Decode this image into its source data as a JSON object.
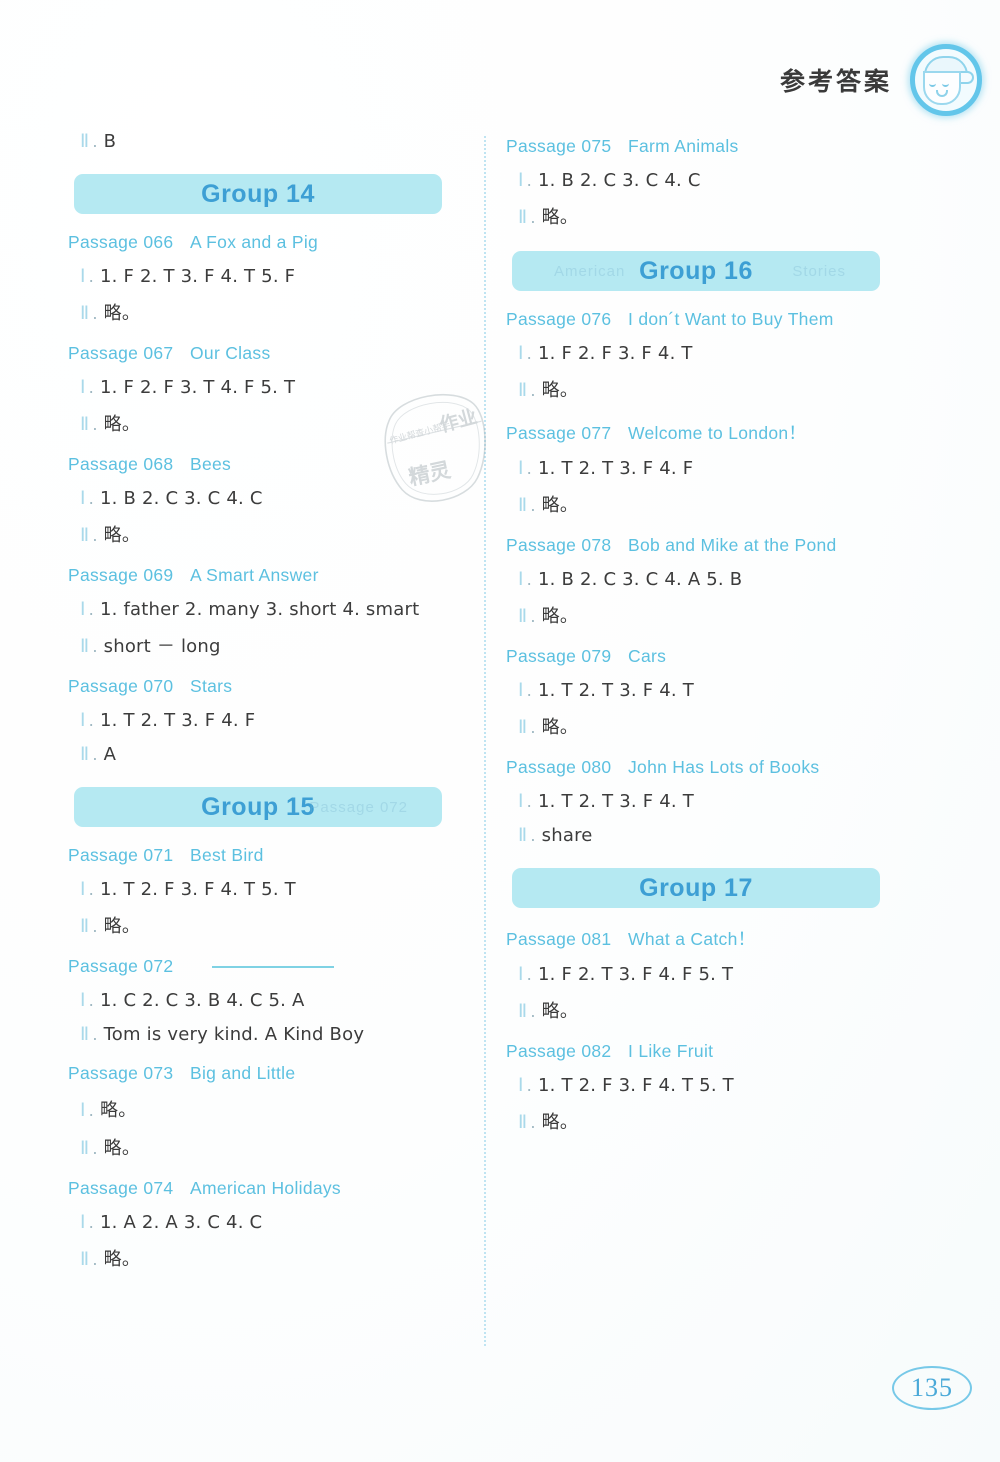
{
  "header": {
    "title": "参考答案",
    "mascot_icon": "boy-with-cap-avatar-icon"
  },
  "page_number": "135",
  "watermark": {
    "text_top": "作业",
    "text_mid": "作业帮查小帮手",
    "text_bottom": "精灵"
  },
  "left_column": {
    "orphan_answer": {
      "numeral": "Ⅱ",
      "text": "B"
    },
    "blocks": [
      {
        "type": "group",
        "title": "Group 14",
        "ghost_left": "",
        "ghost_right": ""
      },
      {
        "type": "passage",
        "number": "Passage 066",
        "title": "A Fox and a Pig",
        "answers": [
          {
            "numeral": "Ⅰ",
            "text": "1. F  2. T  3. F  4. T  5. F"
          },
          {
            "numeral": "Ⅱ",
            "text": "略。"
          }
        ]
      },
      {
        "type": "passage",
        "number": "Passage 067",
        "title": "Our Class",
        "answers": [
          {
            "numeral": "Ⅰ",
            "text": "1. F  2. F  3. T  4. F  5. T"
          },
          {
            "numeral": "Ⅱ",
            "text": "略。"
          }
        ]
      },
      {
        "type": "passage",
        "number": "Passage 068",
        "title": "Bees",
        "answers": [
          {
            "numeral": "Ⅰ",
            "text": "1. B  2. C  3. C  4. C"
          },
          {
            "numeral": "Ⅱ",
            "text": "略。"
          }
        ]
      },
      {
        "type": "passage",
        "number": "Passage 069",
        "title": "A Smart Answer",
        "answers": [
          {
            "numeral": "Ⅰ",
            "text": "1. father  2. many  3. short  4. smart"
          },
          {
            "numeral": "Ⅱ",
            "text": "short － long"
          }
        ]
      },
      {
        "type": "passage",
        "number": "Passage 070",
        "title": "Stars",
        "answers": [
          {
            "numeral": "Ⅰ",
            "text": "1. T  2. T  3. F  4. F"
          },
          {
            "numeral": "Ⅱ",
            "text": "A"
          }
        ]
      },
      {
        "type": "group",
        "title": "Group 15",
        "ghost_left": "",
        "ghost_right": "Passage 072"
      },
      {
        "type": "passage",
        "number": "Passage 071",
        "title": "Best Bird",
        "answers": [
          {
            "numeral": "Ⅰ",
            "text": "1. T  2. F  3. F  4. T  5. T"
          },
          {
            "numeral": "Ⅱ",
            "text": "略。"
          }
        ]
      },
      {
        "type": "passage",
        "number": "Passage 072",
        "title": "",
        "title_is_blank": true,
        "answers": [
          {
            "numeral": "Ⅰ",
            "text": "1. C  2. C  3. B  4. C  5. A"
          },
          {
            "numeral": "Ⅱ",
            "text": "Tom is very kind.    A Kind Boy"
          }
        ]
      },
      {
        "type": "passage",
        "number": "Passage 073",
        "title": "Big and Little",
        "answers": [
          {
            "numeral": "Ⅰ",
            "text": "略。"
          },
          {
            "numeral": "Ⅱ",
            "text": "略。"
          }
        ]
      },
      {
        "type": "passage",
        "number": "Passage 074",
        "title": "American Holidays",
        "answers": [
          {
            "numeral": "Ⅰ",
            "text": "1. A  2. A  3. C  4. C"
          },
          {
            "numeral": "Ⅱ",
            "text": "略。"
          }
        ]
      }
    ]
  },
  "right_column": {
    "blocks": [
      {
        "type": "passage",
        "number": "Passage 075",
        "title": "Farm Animals",
        "answers": [
          {
            "numeral": "Ⅰ",
            "text": "1. B  2. C  3. C  4. C"
          },
          {
            "numeral": "Ⅱ",
            "text": "略。"
          }
        ]
      },
      {
        "type": "group",
        "title": "Group 16",
        "ghost_left": "American",
        "ghost_right": "Stories"
      },
      {
        "type": "passage",
        "number": "Passage 076",
        "title": "I don´t Want to Buy Them",
        "answers": [
          {
            "numeral": "Ⅰ",
            "text": "1. F  2. F  3. F   4. T"
          },
          {
            "numeral": "Ⅱ",
            "text": "略。"
          }
        ]
      },
      {
        "type": "passage",
        "number": "Passage 077",
        "title": "Welcome to London！",
        "answers": [
          {
            "numeral": "Ⅰ",
            "text": "1. T  2. T  3. F   4. F"
          },
          {
            "numeral": "Ⅱ",
            "text": "略。"
          }
        ]
      },
      {
        "type": "passage",
        "number": "Passage 078",
        "title": "Bob and Mike at the Pond",
        "answers": [
          {
            "numeral": "Ⅰ",
            "text": "1. B  2. C  3. C  4. A  5. B"
          },
          {
            "numeral": "Ⅱ",
            "text": "略。"
          }
        ]
      },
      {
        "type": "passage",
        "number": "Passage 079",
        "title": "Cars",
        "answers": [
          {
            "numeral": "Ⅰ",
            "text": "1. T  2. T  3. F  4. T"
          },
          {
            "numeral": "Ⅱ",
            "text": "略。"
          }
        ]
      },
      {
        "type": "passage",
        "number": "Passage 080",
        "title": "John Has Lots of Books",
        "answers": [
          {
            "numeral": "Ⅰ",
            "text": "1. T  2. T  3. F  4. T"
          },
          {
            "numeral": "Ⅱ",
            "text": "share"
          }
        ]
      },
      {
        "type": "group",
        "title": "Group 17",
        "ghost_left": "",
        "ghost_right": ""
      },
      {
        "type": "passage",
        "number": "Passage 081",
        "title": "What a Catch！",
        "answers": [
          {
            "numeral": "Ⅰ",
            "text": "1. F  2. T  3. F  4. F  5. T"
          },
          {
            "numeral": "Ⅱ",
            "text": "略。"
          }
        ]
      },
      {
        "type": "passage",
        "number": "Passage 082",
        "title": "I Like Fruit",
        "answers": [
          {
            "numeral": "Ⅰ",
            "text": "1. T  2. F  3. F  4. T  5. T"
          },
          {
            "numeral": "Ⅱ",
            "text": "略。"
          }
        ]
      }
    ]
  }
}
